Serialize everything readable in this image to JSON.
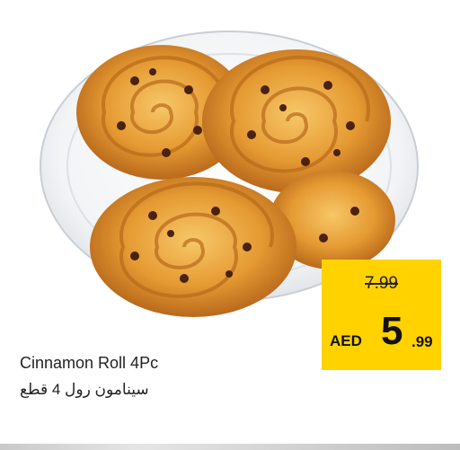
{
  "product": {
    "name_en": "Cinnamon Roll 4Pc",
    "name_ar": "سينامون رول 4 قطع",
    "image_icon": "cinnamon-rolls-on-plate-icon"
  },
  "price": {
    "old": "7.99",
    "currency": "AED",
    "main": "5",
    "decimal": ".99"
  },
  "colors": {
    "price_tag": "#ffd200",
    "pastry": "#e9a13b",
    "plate": "#eef1f4"
  }
}
